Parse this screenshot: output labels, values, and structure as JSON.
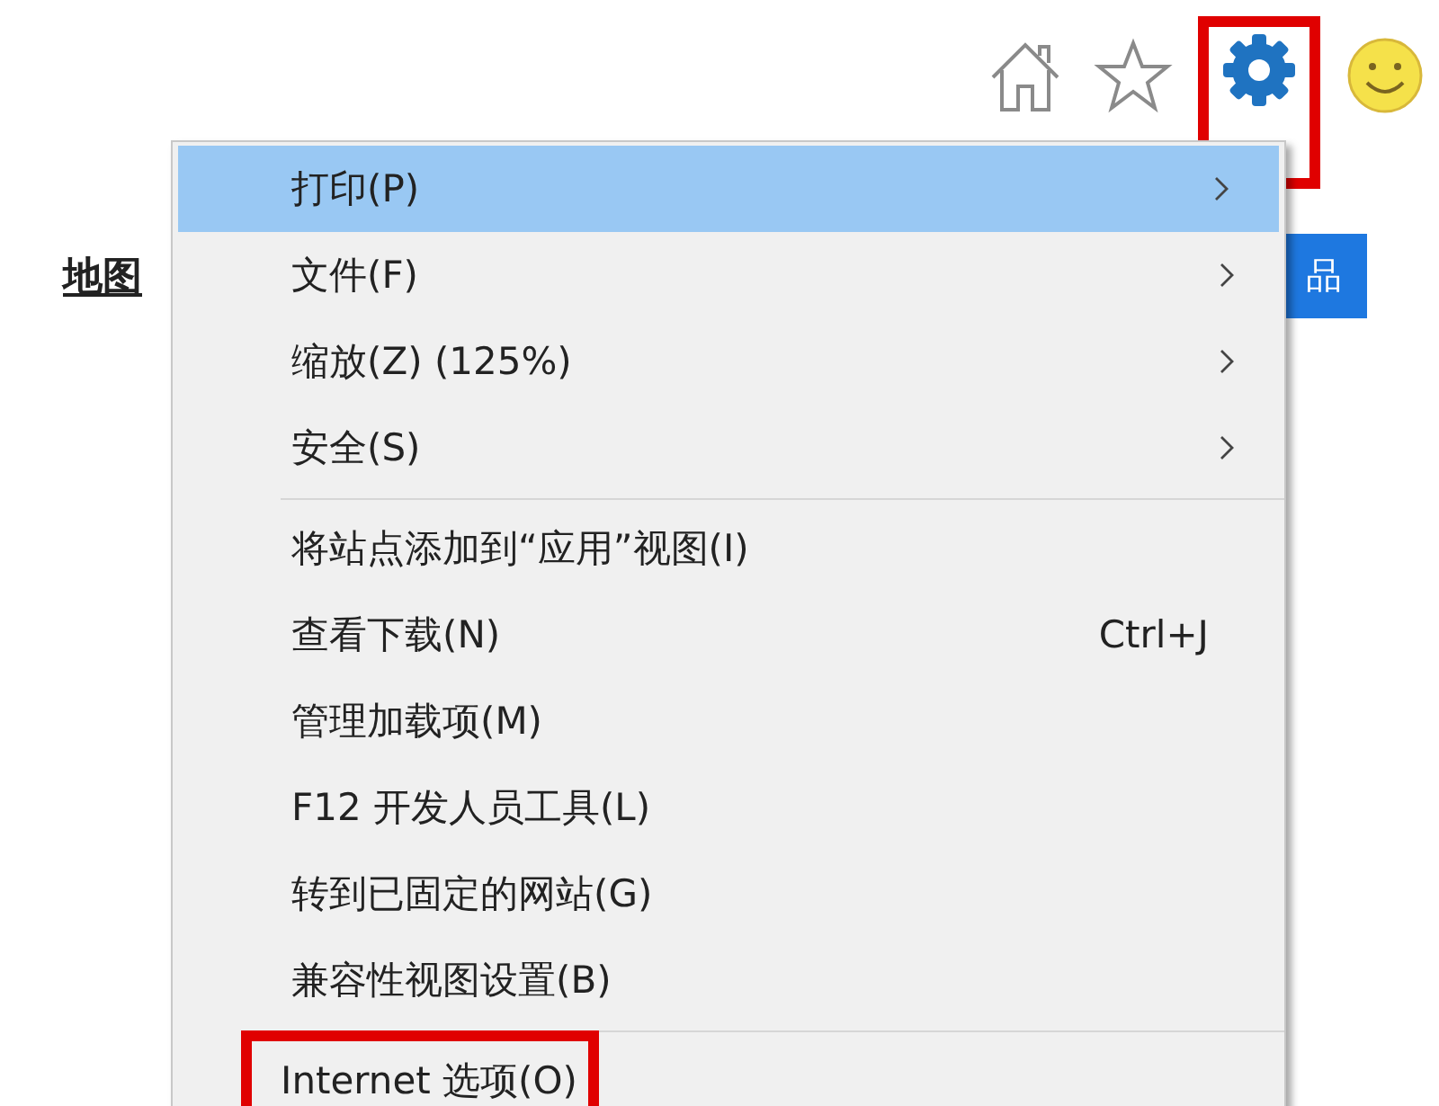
{
  "toolbar": {
    "icons": [
      {
        "kind": "home",
        "highlighted": false
      },
      {
        "kind": "star",
        "highlighted": false
      },
      {
        "kind": "gear",
        "highlighted": true
      },
      {
        "kind": "smiley",
        "highlighted": false
      }
    ]
  },
  "page": {
    "link": "地图",
    "button": "品"
  },
  "menu": {
    "groups": [
      [
        {
          "label": "打印(P)",
          "submenu": true,
          "selected": true,
          "highlighted": false
        },
        {
          "label": "文件(F)",
          "submenu": true,
          "selected": false,
          "highlighted": false
        },
        {
          "label": "缩放(Z) (125%)",
          "submenu": true,
          "selected": false,
          "highlighted": false
        },
        {
          "label": "安全(S)",
          "submenu": true,
          "selected": false,
          "highlighted": false
        }
      ],
      [
        {
          "label": "将站点添加到“应用”视图(I)",
          "submenu": false,
          "selected": false,
          "highlighted": false
        },
        {
          "label": "查看下载(N)",
          "shortcut": "Ctrl+J",
          "submenu": false,
          "selected": false,
          "highlighted": false
        },
        {
          "label": "管理加载项(M)",
          "submenu": false,
          "selected": false,
          "highlighted": false
        },
        {
          "label": "F12 开发人员工具(L)",
          "submenu": false,
          "selected": false,
          "highlighted": false
        },
        {
          "label": "转到已固定的网站(G)",
          "submenu": false,
          "selected": false,
          "highlighted": false
        },
        {
          "label": "兼容性视图设置(B)",
          "submenu": false,
          "selected": false,
          "highlighted": false
        }
      ],
      [
        {
          "label": "Internet 选项(O)",
          "submenu": false,
          "selected": false,
          "highlighted": true
        }
      ]
    ]
  }
}
